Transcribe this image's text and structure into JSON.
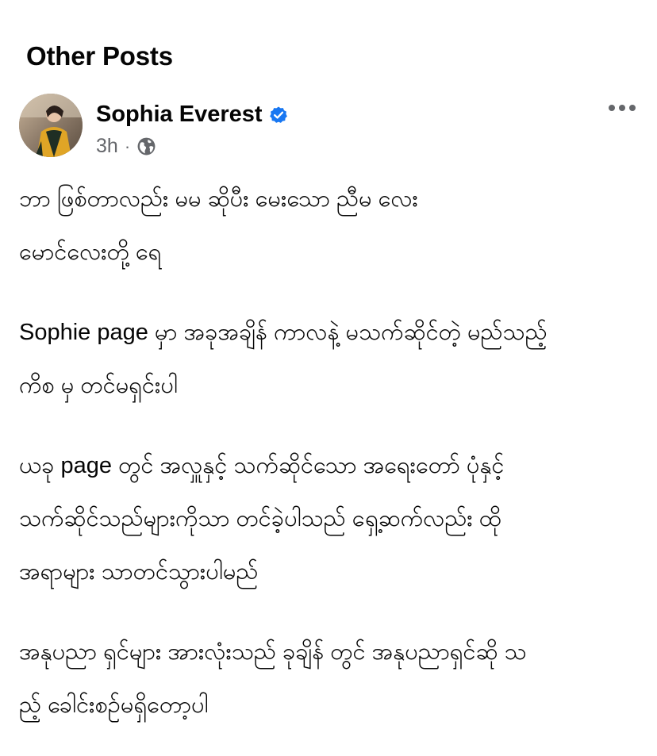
{
  "section": {
    "title": "Other Posts"
  },
  "post": {
    "author": {
      "name": "Sophia Everest",
      "verified": true
    },
    "timestamp": "3h",
    "separator": "·",
    "audience_icon": "globe-icon",
    "more_icon": "more-horizontal-icon",
    "paragraphs": [
      "ဘာ ဖြစ်တာလည်း မမ ဆိုပီး မေးသော ညီမ လေး\nမောင်လေးတို့ ရေ",
      "Sophie page မှာ အခုအချိန် ကာလနဲ့ မသက်ဆိုင်တဲ့ မည်သည့်\nကိစ မှ တင်မရှင်းပါ",
      "ယခု page တွင် အလှူနှင့် သက်ဆိုင်သော အရေးတော် ပုံနှင့်\nသက်ဆိုင်သည်များကိုသာ တင်ခဲ့ပါသည် ရှေ့ဆက်လည်း ထို\nအရာများ သာတင်သွားပါမည်",
      "အနုပညာ ရှင်များ အားလုံးသည် ခုချိန် တွင် အနုပညာရှင်ဆို သ\nည့် ခေါင်းစဉ်မရှိတော့ပါ"
    ]
  },
  "colors": {
    "text_primary": "#050505",
    "text_secondary": "#65676b",
    "verified_blue": "#1877f2",
    "background": "#ffffff"
  }
}
